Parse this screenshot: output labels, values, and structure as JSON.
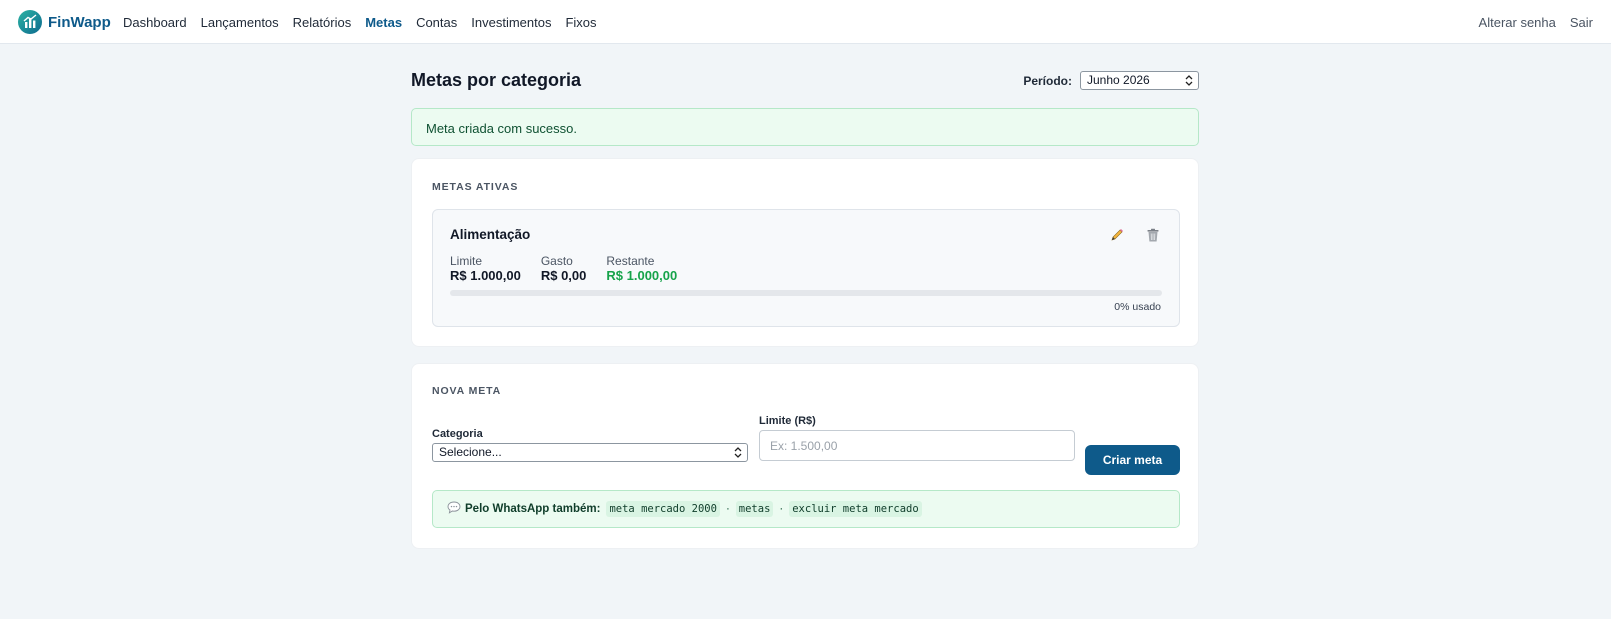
{
  "brand": {
    "name": "FinWapp"
  },
  "nav": {
    "links": [
      {
        "label": "Dashboard"
      },
      {
        "label": "Lançamentos"
      },
      {
        "label": "Relatórios"
      },
      {
        "label": "Metas",
        "active": true
      },
      {
        "label": "Contas"
      },
      {
        "label": "Investimentos"
      },
      {
        "label": "Fixos"
      }
    ],
    "right": [
      {
        "label": "Alterar senha"
      },
      {
        "label": "Sair"
      }
    ]
  },
  "page": {
    "title": "Metas por categoria",
    "period_label": "Período:",
    "period_value": "Junho 2026"
  },
  "alert": {
    "message": "Meta criada com sucesso."
  },
  "active_goals": {
    "section_label": "METAS ATIVAS",
    "goals": [
      {
        "category": "Alimentação",
        "limit_label": "Limite",
        "limit_value": "R$ 1.000,00",
        "spent_label": "Gasto",
        "spent_value": "R$ 0,00",
        "remaining_label": "Restante",
        "remaining_value": "R$ 1.000,00",
        "progress_fraction": 0,
        "usage_text": "0% usado"
      }
    ]
  },
  "new_goal": {
    "section_label": "NOVA META",
    "category_label": "Categoria",
    "category_value": "Selecione...",
    "limit_label": "Limite (R$)",
    "limit_placeholder": "Ex: 1.500,00",
    "submit_label": "Criar meta",
    "whatsapp": {
      "title": "Pelo WhatsApp também:",
      "commands": [
        "meta mercado 2000",
        "metas",
        "excluir meta mercado"
      ],
      "separator": "·"
    }
  },
  "colors": {
    "brand": "#0e5a8a",
    "positive": "#16a34a",
    "success_bg": "#ecfbf1",
    "page_bg": "#f1f5f8"
  },
  "icons": {
    "logo": "chart-logo-icon",
    "edit": "pencil-icon",
    "delete": "trash-icon",
    "whatsapp": "speech-bubble-icon",
    "select": "chevron-updown-icon"
  }
}
